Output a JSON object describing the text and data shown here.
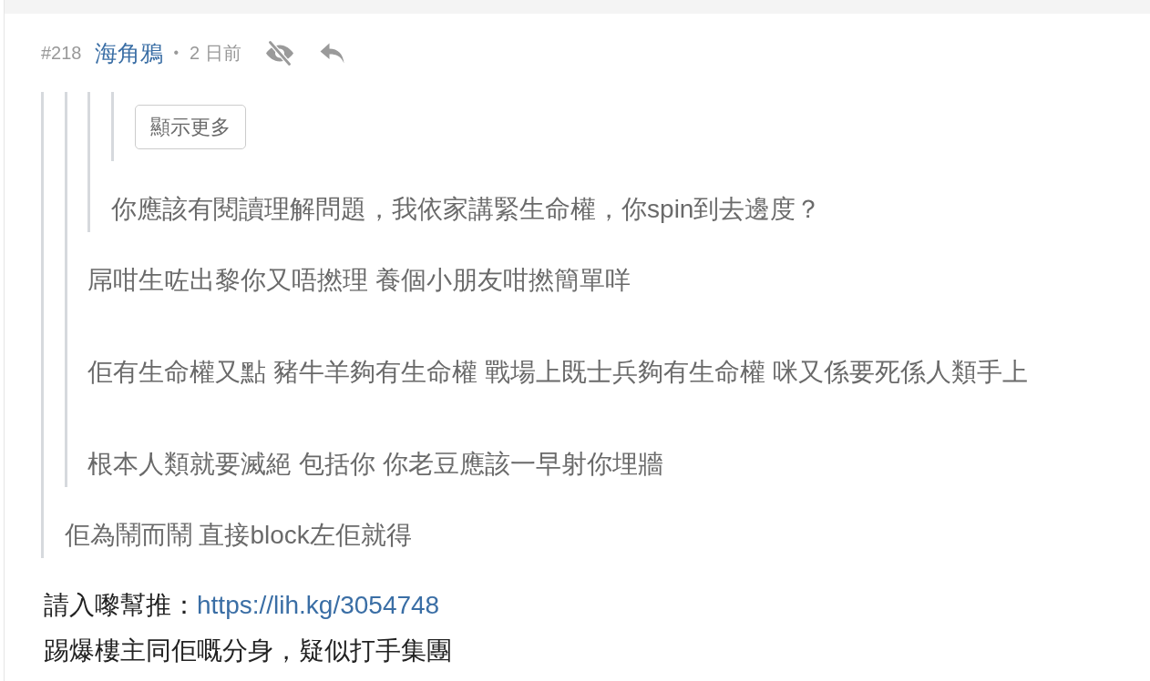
{
  "post": {
    "number": "#218",
    "author": "海角鴉",
    "separator": "•",
    "time": "2 日前",
    "quote": {
      "kind": "quote",
      "children": [
        {
          "kind": "quote",
          "children": [
            {
              "kind": "quote",
              "children": [
                {
                  "kind": "quote",
                  "children": [
                    {
                      "kind": "button",
                      "label": "顯示更多"
                    }
                  ]
                },
                {
                  "kind": "text",
                  "lines": [
                    "你應該有閱讀理解問題，我依家講緊生命權，你spin到去邊度？"
                  ]
                }
              ]
            },
            {
              "kind": "text",
              "lines": [
                "屌咁生咗出黎你又唔撚理 養個小朋友咁撚簡單咩",
                "佢有生命權又點 豬牛羊夠有生命權 戰場上既士兵夠有生命權 咪又係要死係人類手上",
                "根本人類就要滅絕 包括你 你老豆應該一早射你埋牆"
              ]
            }
          ]
        },
        {
          "kind": "text",
          "lines": [
            "佢為鬧而鬧 直接block左佢就得"
          ]
        }
      ]
    },
    "body": [
      {
        "text": "請入嚟幫推：",
        "link": "https://lih.kg/3054748"
      },
      {
        "text": "踢爆樓主同佢嘅分身，疑似打手集團"
      }
    ]
  }
}
